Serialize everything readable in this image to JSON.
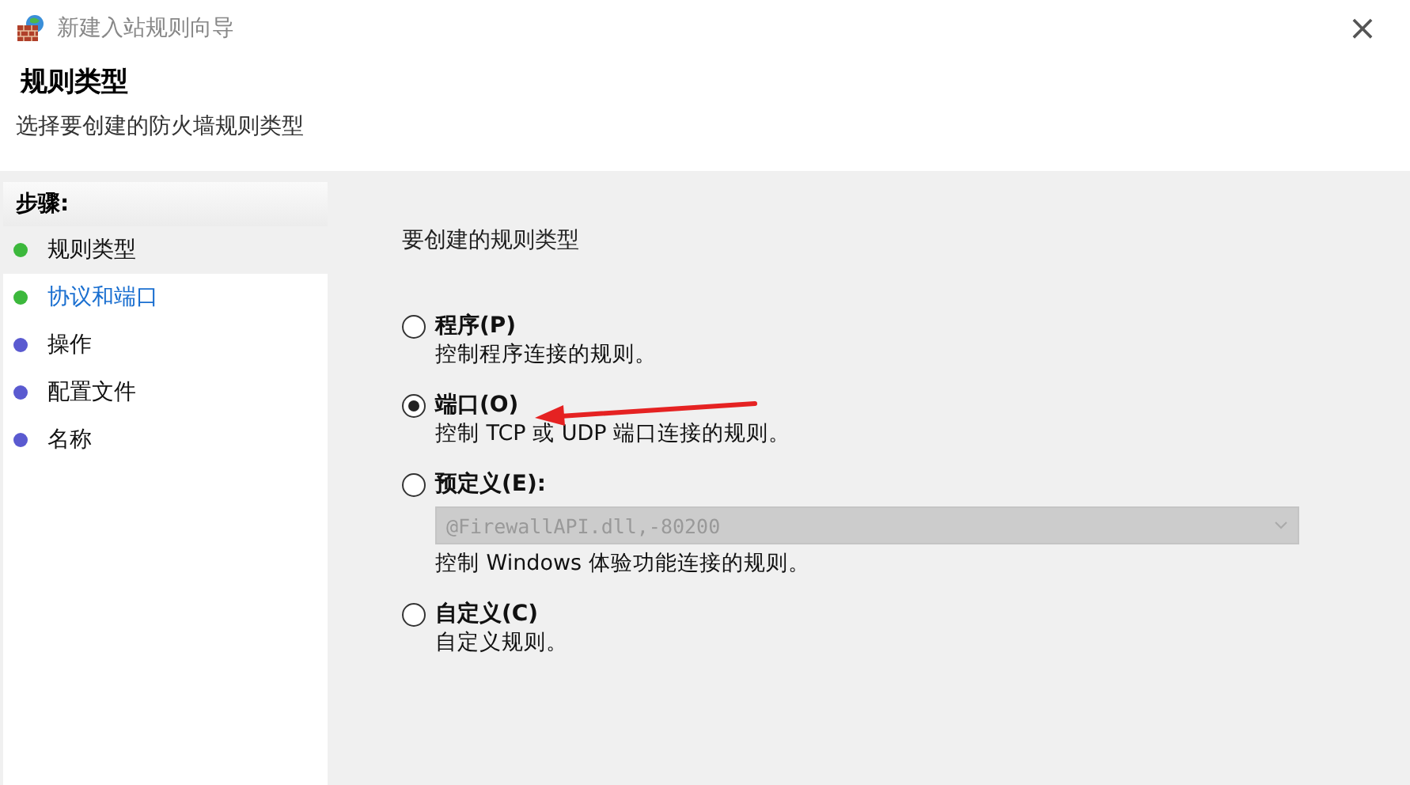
{
  "window": {
    "title": "新建入站规则向导",
    "close": "×"
  },
  "header": {
    "title": "规则类型",
    "subtitle": "选择要创建的防火墙规则类型"
  },
  "steps": {
    "heading": "步骤:",
    "items": [
      {
        "label": "规则类型",
        "color": "#3cb83c",
        "selected": true,
        "link": false
      },
      {
        "label": "协议和端口",
        "color": "#3cb83c",
        "selected": false,
        "link": true
      },
      {
        "label": "操作",
        "color": "#5a5ad0",
        "selected": false,
        "link": false
      },
      {
        "label": "配置文件",
        "color": "#5a5ad0",
        "selected": false,
        "link": false
      },
      {
        "label": "名称",
        "color": "#5a5ad0",
        "selected": false,
        "link": false
      }
    ]
  },
  "content": {
    "prompt": "要创建的规则类型",
    "options": [
      {
        "kind": "plain",
        "label": "程序(P)",
        "description": "控制程序连接的规则。",
        "selected": false
      },
      {
        "kind": "plain",
        "label": "端口(O)",
        "description": "控制 TCP 或 UDP 端口连接的规则。",
        "selected": true
      },
      {
        "kind": "dropdown",
        "label": "预定义(E):",
        "dropdown": {
          "value": "@FirewallAPI.dll,-80200",
          "disabled": true
        },
        "description": "控制 Windows 体验功能连接的规则。",
        "selected": false
      },
      {
        "kind": "plain",
        "label": "自定义(C)",
        "description": "自定义规则。",
        "selected": false
      }
    ]
  }
}
